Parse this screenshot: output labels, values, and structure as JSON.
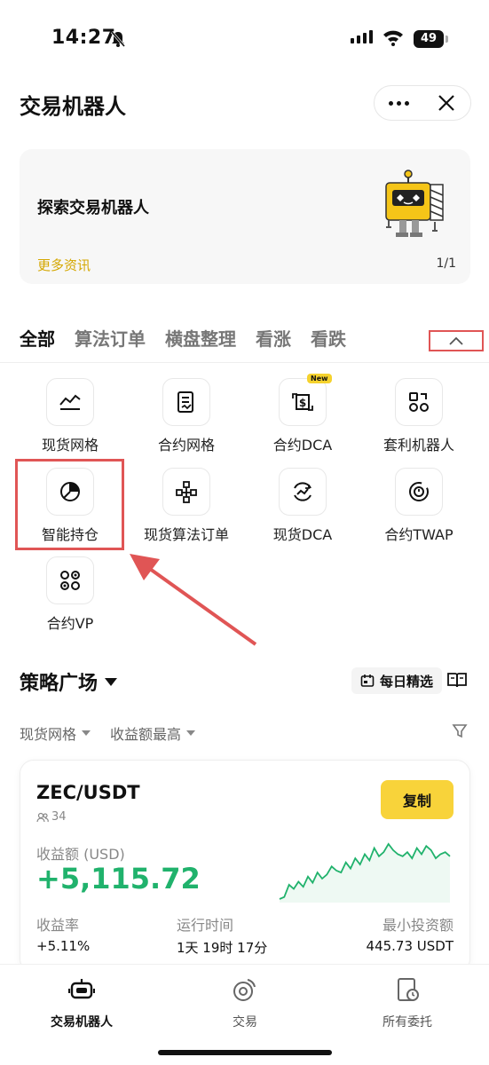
{
  "status_bar": {
    "time": "14:27",
    "battery": "49"
  },
  "header": {
    "title": "交易机器人",
    "more_icon": "more-horizontal-icon",
    "close_icon": "close-icon"
  },
  "banner": {
    "title": "探索交易机器人",
    "link": "更多资讯",
    "page": "1/1",
    "illustration": "robot-illustration"
  },
  "tabs": [
    "全部",
    "算法订单",
    "横盘整理",
    "看涨",
    "看跌"
  ],
  "bots": [
    {
      "label": "现货网格",
      "icon": "grid-chart-icon"
    },
    {
      "label": "合约网格",
      "icon": "contract-doc-icon"
    },
    {
      "label": "合约DCA",
      "icon": "dollar-refresh-icon",
      "badge": "New"
    },
    {
      "label": "套利机器人",
      "icon": "arbitrage-icon"
    },
    {
      "label": "智能持仓",
      "icon": "pie-chart-icon"
    },
    {
      "label": "现货算法订单",
      "icon": "flow-nodes-icon"
    },
    {
      "label": "现货DCA",
      "icon": "trend-refresh-icon"
    },
    {
      "label": "合约TWAP",
      "icon": "timer-ring-icon"
    },
    {
      "label": "合约VP",
      "icon": "dots-cluster-icon"
    }
  ],
  "plaza": {
    "title": "策略广场",
    "daily_pick": "每日精选",
    "filters": [
      "现货网格",
      "收益额最高"
    ]
  },
  "card": {
    "pair": "ZEC/USDT",
    "users": "34",
    "copy_label": "复制",
    "profit_label": "收益额 (USD)",
    "profit_value": "+5,115.72",
    "stats": [
      {
        "label": "收益率",
        "value": "+5.11%"
      },
      {
        "label": "运行时间",
        "value": "1天 19时 17分"
      },
      {
        "label": "最小投资额",
        "value": "445.73 USDT"
      }
    ],
    "sparkline": [
      8,
      10,
      22,
      18,
      25,
      20,
      30,
      24,
      34,
      28,
      32,
      40,
      36,
      34,
      44,
      38,
      48,
      42,
      52,
      46,
      58,
      50,
      54,
      62,
      56,
      52,
      50,
      54,
      48,
      58,
      52,
      60,
      56,
      48,
      52,
      54,
      50
    ],
    "accent": "#20b26c"
  },
  "bottom_nav": [
    {
      "label": "交易机器人",
      "icon": "robot-icon",
      "active": true
    },
    {
      "label": "交易",
      "icon": "trade-swap-icon",
      "active": false
    },
    {
      "label": "所有委托",
      "icon": "orders-clock-icon",
      "active": false
    }
  ]
}
